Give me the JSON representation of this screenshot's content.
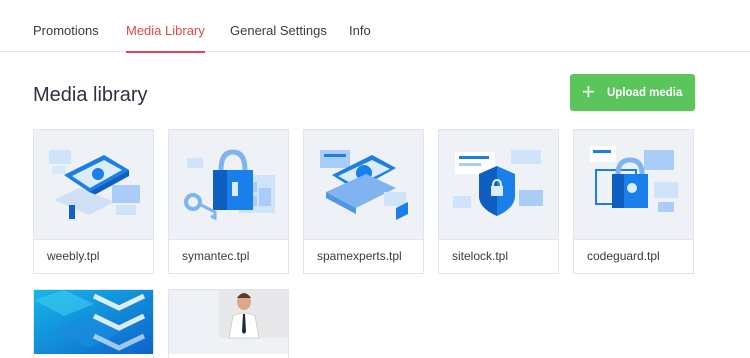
{
  "tabs": [
    {
      "label": "Promotions",
      "active": false
    },
    {
      "label": "Media Library",
      "active": true
    },
    {
      "label": "General Settings",
      "active": false
    },
    {
      "label": "Info",
      "active": false
    }
  ],
  "page_title": "Media library",
  "upload_button": {
    "label": "Upload media",
    "icon": "plus-icon",
    "color": "#5bc55b"
  },
  "accent_color": "#e0474c",
  "media": [
    {
      "name": "weebly.tpl",
      "icon": "weebly-illustration"
    },
    {
      "name": "symantec.tpl",
      "icon": "symantec-lock-illustration"
    },
    {
      "name": "spamexperts.tpl",
      "icon": "spamexperts-laptop-illustration"
    },
    {
      "name": "sitelock.tpl",
      "icon": "sitelock-shield-illustration"
    },
    {
      "name": "codeguard.tpl",
      "icon": "codeguard-lock-illustration"
    },
    {
      "name": "",
      "icon": "blue-banner-image"
    },
    {
      "name": "",
      "icon": "person-photo"
    }
  ]
}
